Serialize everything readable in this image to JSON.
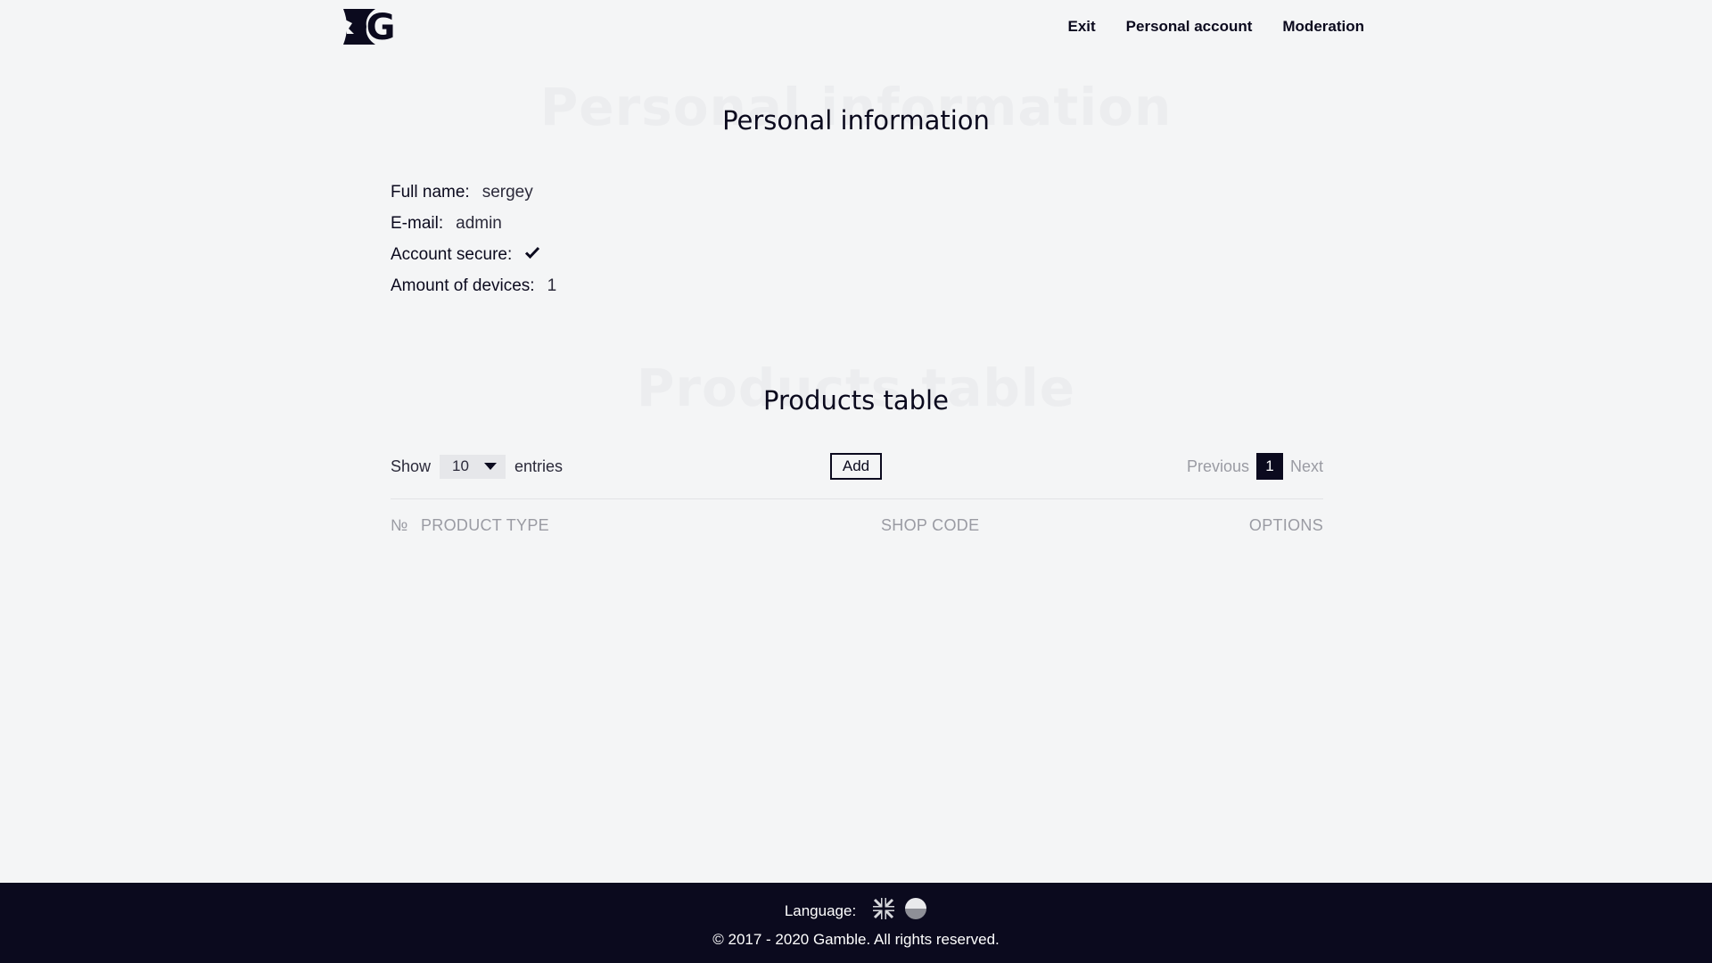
{
  "header": {
    "logo_text": "G",
    "nav": [
      "Exit",
      "Personal account",
      "Moderation"
    ]
  },
  "personal": {
    "ghost_title": "Personal information",
    "title": "Personal information",
    "fields": [
      {
        "label": "Full name:",
        "value": "sergey"
      },
      {
        "label": "E-mail:",
        "value": "admin"
      },
      {
        "label": "Account secure:",
        "value": "",
        "icon": "checkmark-icon"
      },
      {
        "label": "Amount of devices:",
        "value": "1"
      }
    ]
  },
  "products": {
    "ghost_title": "Products table",
    "title": "Products table",
    "show_label": "Show",
    "entries_value": "10",
    "entries_label": "entries",
    "add_label": "Add",
    "pager": {
      "previous": "Previous",
      "current": "1",
      "next": "Next"
    },
    "columns": [
      "№",
      "PRODUCT TYPE",
      "SHOP CODE",
      "OPTIONS"
    ]
  },
  "footer": {
    "language_label": "Language:",
    "flags": [
      "uk-flag-icon",
      "other-flag-icon"
    ],
    "copyright": "© 2017 - 2020 Gamble. All rights reserved."
  },
  "colors": {
    "dark": "#0b0a1e",
    "background": "#f4f5f6",
    "muted": "#9a9ba3"
  }
}
